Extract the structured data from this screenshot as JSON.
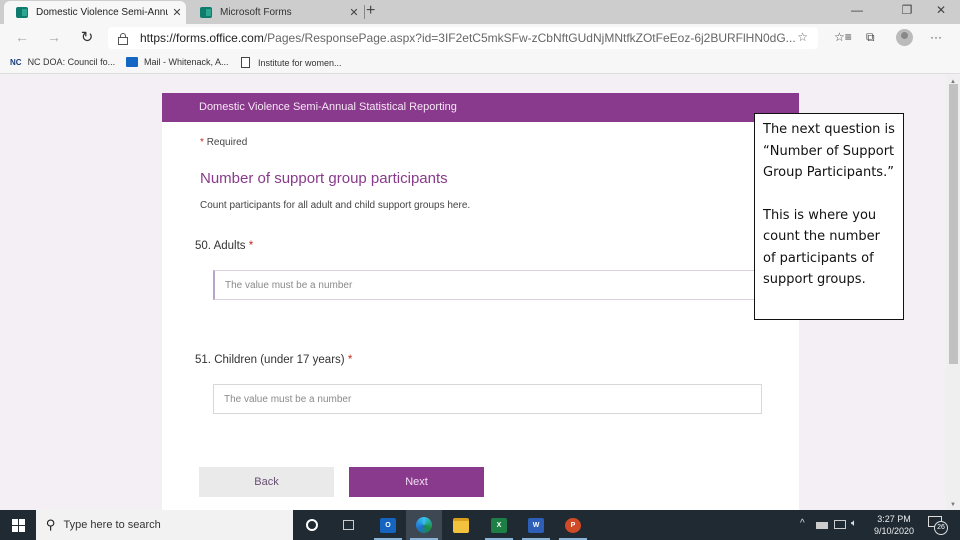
{
  "browser": {
    "tabs": [
      {
        "title": "Domestic Violence Semi-Annual",
        "active": true,
        "icon": "forms-icon"
      },
      {
        "title": "Microsoft Forms",
        "active": false,
        "icon": "forms-icon"
      }
    ],
    "new_tab_label": "+",
    "close_tab_glyph": "✕",
    "window_controls": {
      "minimize": "—",
      "restore": "❐",
      "close": "✕"
    },
    "nav": {
      "back": "←",
      "forward": "→",
      "refresh": "↻"
    },
    "address": {
      "host": "https://forms.office.com",
      "path": "/Pages/ResponsePage.aspx?id=3IF2etC5mkSFw-zCbNftGUdNjMNtfkZOtFeEoz-6j2BURFlHN0dG..."
    },
    "toolbar_icons": {
      "favorite": "☆",
      "favorites_list": "☆≡",
      "collections": "⧉",
      "more": "···"
    },
    "bookmarks": [
      {
        "prefix": "NC",
        "label": "NC DOA: Council fo...",
        "icon": "nc-icon"
      },
      {
        "label": "Mail - Whitenack, A...",
        "icon": "outlook-icon"
      },
      {
        "label": "Institute for women...",
        "icon": "document-icon"
      }
    ]
  },
  "form": {
    "header": "Domestic Violence Semi-Annual Statistical Reporting",
    "required_star": "*",
    "required_note": "Required",
    "section_title": "Number of support group participants",
    "section_description": "Count participants for all adult and child support groups here.",
    "questions": [
      {
        "number": "50.",
        "label": "Adults",
        "required_mark": "*",
        "value": "",
        "placeholder": "The value must be a number"
      },
      {
        "number": "51.",
        "label": "Children (under 17 years)",
        "required_mark": "*",
        "value": "",
        "placeholder": "The value must be a number"
      }
    ],
    "buttons": {
      "back": "Back",
      "next": "Next"
    },
    "accent_color": "#8a3a8c"
  },
  "callout": {
    "paragraph1": "The next question is “Number of Support Group Participants.”",
    "paragraph2": "This is where you count the number of participants of support groups."
  },
  "taskbar": {
    "search_placeholder": "Type here to search",
    "apps": [
      "cortana",
      "task-view",
      "outlook",
      "edge",
      "file-explorer",
      "excel",
      "word",
      "powerpoint"
    ],
    "app_letters": {
      "outlook": "O",
      "excel": "X",
      "word": "W",
      "powerpoint": "P"
    },
    "tray_icons": {
      "chevron": "^",
      "volume": "🔈︎"
    },
    "time": "3:27 PM",
    "date": "9/10/2020",
    "notification_count": "26"
  }
}
